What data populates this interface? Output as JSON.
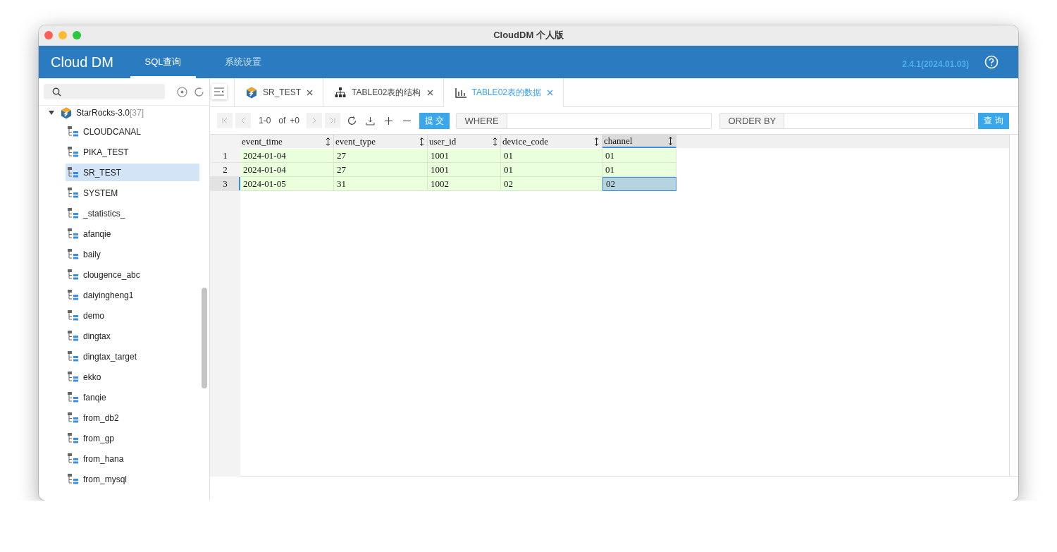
{
  "window": {
    "title": "CloudDM 个人版"
  },
  "header": {
    "logo": "Cloud DM",
    "nav": [
      {
        "label": "SQL查询",
        "selected": true
      },
      {
        "label": "系统设置",
        "selected": false
      }
    ],
    "version": "2.4.1(2024.01.03)"
  },
  "sidebar": {
    "tree": {
      "label": "StarRocks-3.0",
      "count": "[37]",
      "expanded": true,
      "children": [
        {
          "label": "CLOUDCANAL",
          "selected": false
        },
        {
          "label": "PIKA_TEST",
          "selected": false
        },
        {
          "label": "SR_TEST",
          "selected": true
        },
        {
          "label": "SYSTEM",
          "selected": false
        },
        {
          "label": "_statistics_",
          "selected": false
        },
        {
          "label": "afanqie",
          "selected": false
        },
        {
          "label": "baily",
          "selected": false
        },
        {
          "label": "clougence_abc",
          "selected": false
        },
        {
          "label": "daiyingheng1",
          "selected": false
        },
        {
          "label": "demo",
          "selected": false
        },
        {
          "label": "dingtax",
          "selected": false
        },
        {
          "label": "dingtax_target",
          "selected": false
        },
        {
          "label": "ekko",
          "selected": false
        },
        {
          "label": "fanqie",
          "selected": false
        },
        {
          "label": "from_db2",
          "selected": false
        },
        {
          "label": "from_gp",
          "selected": false
        },
        {
          "label": "from_hana",
          "selected": false
        },
        {
          "label": "from_mysql",
          "selected": false
        }
      ]
    }
  },
  "tabs": [
    {
      "label": "SR_TEST",
      "kind": "database",
      "selected": false
    },
    {
      "label": "TABLE02表的结构",
      "kind": "structure",
      "selected": false
    },
    {
      "label": "TABLE02表的数据",
      "kind": "data",
      "selected": true
    }
  ],
  "toolbar": {
    "range": "1-0",
    "of": "of",
    "total": "+0",
    "submit": "提 交",
    "where": "WHERE",
    "order_by": "ORDER BY",
    "query": "查 询"
  },
  "table": {
    "columns": [
      {
        "label": "event_time",
        "selected": false
      },
      {
        "label": "event_type",
        "selected": false
      },
      {
        "label": "user_id",
        "selected": false
      },
      {
        "label": "device_code",
        "selected": false
      },
      {
        "label": "channel",
        "selected": true
      }
    ],
    "rows": [
      {
        "number": "1",
        "selected": false,
        "cells": [
          {
            "text": "2024-01-04",
            "selected": false
          },
          {
            "text": "27",
            "selected": false
          },
          {
            "text": "1001",
            "selected": false
          },
          {
            "text": "01",
            "selected": false
          },
          {
            "text": "01",
            "selected": false
          }
        ]
      },
      {
        "number": "2",
        "selected": false,
        "cells": [
          {
            "text": "2024-01-04",
            "selected": false
          },
          {
            "text": "27",
            "selected": false
          },
          {
            "text": "1001",
            "selected": false
          },
          {
            "text": "01",
            "selected": false
          },
          {
            "text": "01",
            "selected": false
          }
        ]
      },
      {
        "number": "3",
        "selected": true,
        "cells": [
          {
            "text": "2024-01-05",
            "selected": false
          },
          {
            "text": "31",
            "selected": false
          },
          {
            "text": "1002",
            "selected": false
          },
          {
            "text": "02",
            "selected": false
          },
          {
            "text": "02",
            "selected": true
          }
        ]
      }
    ]
  }
}
